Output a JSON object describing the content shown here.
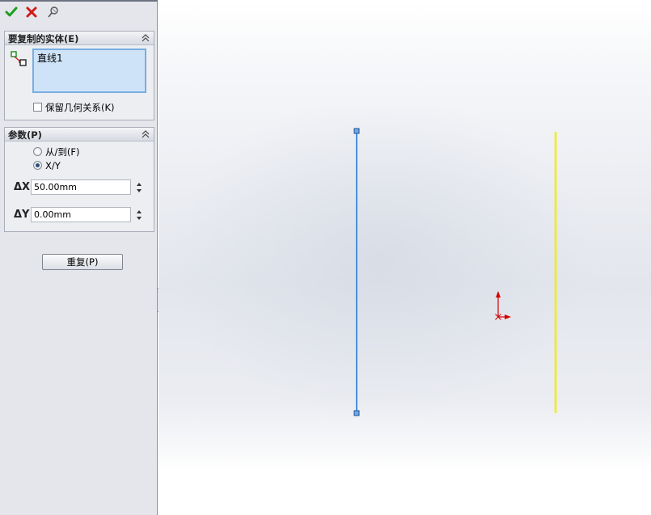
{
  "toolbar": {
    "ok_icon": "green-checkmark-icon",
    "cancel_icon": "red-x-icon",
    "detail_icon": "pushpin-icon"
  },
  "entities_section": {
    "title": "要复制的实体(E)",
    "icon": "sketch-entity-selection-icon",
    "list_items": [
      "直线1"
    ],
    "keep_relations_label": "保留几何关系(K)",
    "keep_relations_checked": false
  },
  "params_section": {
    "title": "参数(P)",
    "options": [
      {
        "label": "从/到(F)",
        "selected": false
      },
      {
        "label": "X/Y",
        "selected": true
      }
    ],
    "dx": {
      "symbol": "ΔX",
      "value": "50.00mm"
    },
    "dy": {
      "symbol": "ΔY",
      "value": "0.00mm"
    }
  },
  "repeat_button": {
    "label": "重复(P)"
  },
  "colors": {
    "selected_line": "#4a90d9",
    "preview_line": "#f2ee00",
    "origin_arrow": "#d40000",
    "panel_bg": "#e4e6ec"
  }
}
